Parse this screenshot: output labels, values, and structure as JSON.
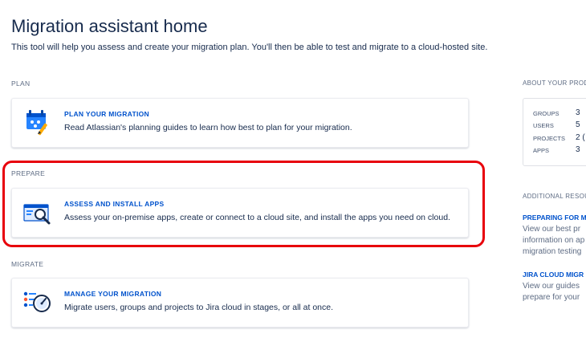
{
  "page": {
    "title": "Migration assistant home",
    "subtitle": "This tool will help you assess and create your migration plan. You'll then be able to test and migrate to a cloud-hosted site."
  },
  "sections": [
    {
      "label": "PLAN",
      "card_title": "PLAN YOUR MIGRATION",
      "card_desc": "Read Atlassian's planning guides to learn how best to plan for your migration.",
      "icon": "planning-icon"
    },
    {
      "label": "PREPARE",
      "card_title": "ASSESS AND INSTALL APPS",
      "card_desc": "Assess your on-premise apps, create or connect to a cloud site, and install the apps you need on cloud.",
      "icon": "assess-apps-icon"
    },
    {
      "label": "MIGRATE",
      "card_title": "MANAGE YOUR MIGRATION",
      "card_desc": "Migrate users, groups and projects to Jira cloud in stages, or all at once.",
      "icon": "manage-migration-icon"
    }
  ],
  "sidebar": {
    "about_label": "ABOUT YOUR PRODU",
    "stats": [
      {
        "label": "GROUPS",
        "value": "3"
      },
      {
        "label": "USERS",
        "value": "5"
      },
      {
        "label": "PROJECTS",
        "value": "2 ("
      },
      {
        "label": "APPS",
        "value": "3"
      }
    ],
    "resources_label": "ADDITIONAL RESOU",
    "resources": [
      {
        "title": "PREPARING FOR M",
        "lines": [
          "View our best pr",
          "information on ap",
          "migration testing"
        ]
      },
      {
        "title": "JIRA CLOUD MIGR",
        "lines": [
          "View our guides",
          "prepare for your"
        ]
      }
    ]
  },
  "colors": {
    "link": "#0052cc",
    "text": "#172b4d",
    "muted": "#5e6c84",
    "highlight": "#e8000b"
  }
}
